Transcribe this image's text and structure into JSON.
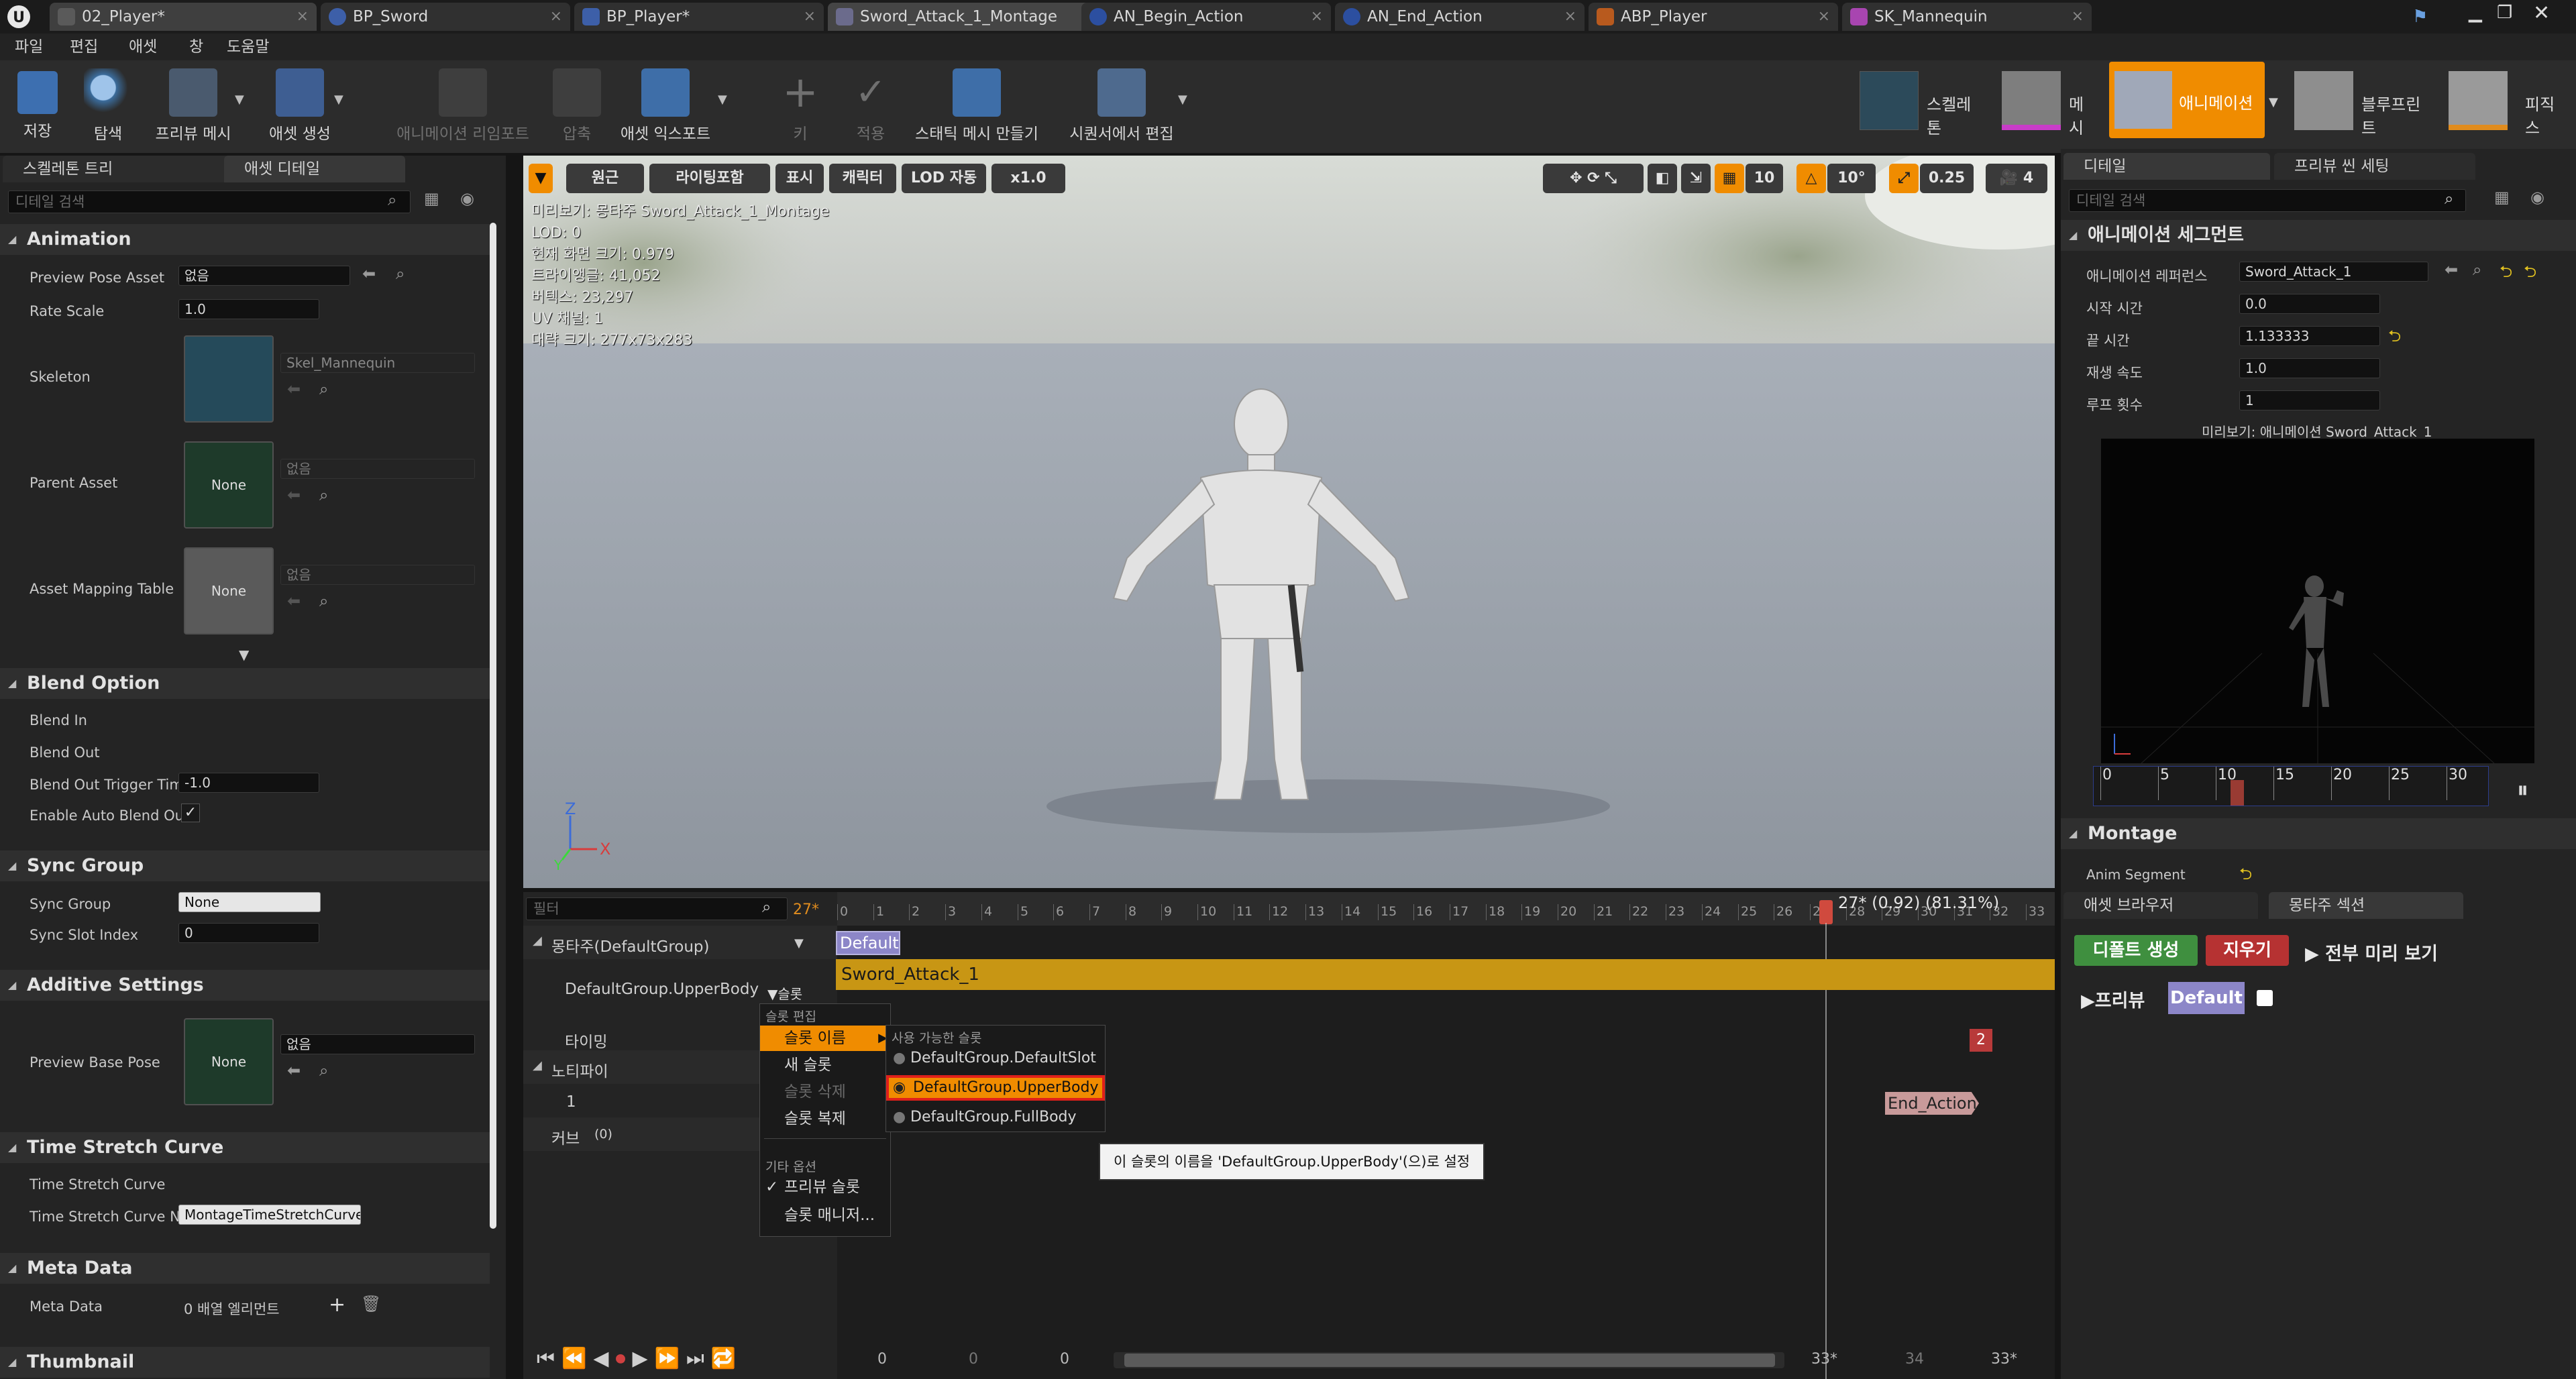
{
  "tabs": [
    {
      "label": "02_Player*",
      "icon": "level-icon"
    },
    {
      "label": "BP_Sword",
      "icon": "blueprint-icon"
    },
    {
      "label": "BP_Player*",
      "icon": "character-blueprint-icon"
    },
    {
      "label": "Sword_Attack_1_Montage",
      "icon": "montage-icon"
    },
    {
      "label": "AN_Begin_Action",
      "icon": "notify-icon"
    },
    {
      "label": "AN_End_Action",
      "icon": "notify-icon"
    },
    {
      "label": "ABP_Player",
      "icon": "anim-blueprint-icon"
    },
    {
      "label": "SK_Mannequin",
      "icon": "skeletal-mesh-icon"
    }
  ],
  "menu": [
    "파일",
    "편집",
    "애셋",
    "창",
    "도움말"
  ],
  "toolbar": [
    {
      "label": "저장",
      "icon": "save-icon",
      "enabled": true
    },
    {
      "label": "탐색",
      "icon": "browse-icon",
      "enabled": true
    },
    {
      "label": "프리뷰 메시",
      "icon": "preview-mesh-icon",
      "enabled": true
    },
    {
      "label": "애셋 생성",
      "icon": "create-asset-icon",
      "enabled": true
    },
    {
      "label": "애니메이션 리임포트",
      "icon": "reimport-icon",
      "enabled": false
    },
    {
      "label": "압축",
      "icon": "compress-icon",
      "enabled": false
    },
    {
      "label": "애셋 익스포트",
      "icon": "export-icon",
      "enabled": true
    },
    {
      "label": "키",
      "icon": "key-icon",
      "enabled": false
    },
    {
      "label": "적용",
      "icon": "apply-icon",
      "enabled": false
    },
    {
      "label": "스태틱 메시 만들기",
      "icon": "static-mesh-icon",
      "enabled": true
    },
    {
      "label": "시퀀서에서 편집",
      "icon": "sequencer-icon",
      "enabled": true
    }
  ],
  "modes": [
    {
      "label": "스켈레톤",
      "active": false
    },
    {
      "label": "메시",
      "active": false
    },
    {
      "label": "애니메이션",
      "active": true
    },
    {
      "label": "블루프린트",
      "active": false
    },
    {
      "label": "피직스",
      "active": false
    }
  ],
  "left_panel": {
    "tabs": [
      "스켈레톤 트리",
      "애셋 디테일"
    ],
    "search_placeholder": "디테일 검색",
    "animation": {
      "title": "Animation",
      "preview_pose_asset_label": "Preview Pose Asset",
      "preview_pose_asset_value": "없음",
      "rate_scale_label": "Rate Scale",
      "rate_scale_value": "1.0",
      "skeleton_label": "Skeleton",
      "skeleton_value": "Skel_Mannequin",
      "parent_asset_label": "Parent Asset",
      "parent_asset_thumb": "None",
      "parent_asset_value": "없음",
      "asset_mapping_label": "Asset Mapping Table",
      "asset_mapping_thumb": "None",
      "asset_mapping_value": "없음"
    },
    "blend_option": {
      "title": "Blend Option",
      "blend_in": "Blend In",
      "blend_out": "Blend Out",
      "trigger_label": "Blend Out Trigger Time",
      "trigger_value": "-1.0",
      "auto_label": "Enable Auto Blend Out",
      "auto_checked": true
    },
    "sync_group": {
      "title": "Sync Group",
      "group_label": "Sync Group",
      "group_value": "None",
      "slot_label": "Sync Slot Index",
      "slot_value": "0"
    },
    "additive": {
      "title": "Additive Settings",
      "pose_label": "Preview Base Pose",
      "pose_thumb": "None",
      "pose_value": "없음"
    },
    "time_stretch": {
      "title": "Time Stretch Curve",
      "curve_label": "Time Stretch Curve",
      "name_label": "Time Stretch Curve Nar",
      "name_value": "MontageTimeStretchCurve"
    },
    "meta": {
      "title": "Meta Data",
      "label": "Meta Data",
      "value": "0 배열 엘리먼트"
    },
    "thumbnail_title": "Thumbnail"
  },
  "viewport": {
    "buttons": [
      "원근",
      "라이팅포함",
      "표시",
      "캐릭터",
      "LOD 자동",
      "x1.0"
    ],
    "grid_snap": "10",
    "rot_snap": "10°",
    "scale_snap": "0.25",
    "cam_speed": "4",
    "hud": [
      "미리보기: 몽타주 Sword_Attack_1_Montage",
      "LOD: 0",
      "현재 화면 크기: 0.979",
      "트라이앵글: 41,052",
      "버텍스: 23,297",
      "UV 채널: 1",
      "대략 크기: 277x73x283"
    ],
    "axes": {
      "z": "Z",
      "x": "X",
      "y": "Y"
    }
  },
  "timeline": {
    "filter_placeholder": "필터",
    "frame_count": "27*",
    "current_time": "27* (0.92) (81.31%)",
    "ruler": [
      "0",
      "1",
      "2",
      "3",
      "4",
      "5",
      "6",
      "7",
      "8",
      "9",
      "10",
      "11",
      "12",
      "13",
      "14",
      "15",
      "16",
      "17",
      "18",
      "19",
      "20",
      "21",
      "22",
      "23",
      "24",
      "25",
      "26",
      "27",
      "28",
      "29",
      "30",
      "31",
      "32",
      "33"
    ],
    "montage_label": "몽타주(DefaultGroup)",
    "section_name": "Default",
    "slot_label": "DefaultGroup.UpperBody",
    "slot_dropdown": "슬롯",
    "segment_name": "Sword_Attack_1",
    "timing_label": "타이밍",
    "timing_marker": "2",
    "notify_label": "노티파이",
    "notify_track": "1",
    "notify_event": "End_Action",
    "curves_label": "커브",
    "curves_count": "(0)",
    "bottom_numbers": [
      "0",
      "0",
      "0",
      "33*",
      "34",
      "33*"
    ]
  },
  "context_menu": {
    "header": "슬롯 편집",
    "items": [
      "슬롯 이름",
      "새 슬롯",
      "슬롯 삭제",
      "슬롯 복제"
    ],
    "other_header": "기타 옵션",
    "other_items": [
      "프리뷰 슬롯",
      "슬롯 매니저..."
    ],
    "submenu_header": "사용 가능한 슬롯",
    "submenu_items": [
      "DefaultGroup.DefaultSlot",
      "DefaultGroup.UpperBody",
      "DefaultGroup.FullBody"
    ],
    "selected_index": 1,
    "tooltip": "이 슬롯의 이름을 'DefaultGroup.UpperBody'(으)로 설정"
  },
  "right_panel": {
    "tabs": [
      "디테일",
      "프리뷰 씬 세팅"
    ],
    "search_placeholder": "디테일 검색",
    "segment_title": "애니메이션 세그먼트",
    "ref_label": "애니메이션 레퍼런스",
    "ref_value": "Sword_Attack_1",
    "start_label": "시작 시간",
    "start_value": "0.0",
    "end_label": "끝 시간",
    "end_value": "1.133333",
    "rate_label": "재생 속도",
    "rate_value": "1.0",
    "loop_label": "루프 횟수",
    "loop_value": "1",
    "preview_caption": "미리보기: 애니메이션 Sword_Attack_1",
    "scrub_labels": [
      "0",
      "5",
      "10",
      "15",
      "20",
      "25",
      "30"
    ],
    "montage_title": "Montage",
    "anim_segment_label": "Anim Segment"
  },
  "sections_panel": {
    "tabs": [
      "애셋 브라우저",
      "몽타주 섹션"
    ],
    "create_default": "디폴트 생성",
    "clear": "지우기",
    "preview_all": "전부 미리 보기",
    "preview": "프리뷰",
    "default_chip": "Default"
  },
  "colors": {
    "accent_orange": "#f08c00",
    "segment_gold": "#c89614",
    "selection_red": "#e0201a",
    "section_purple": "#8c86c8"
  }
}
